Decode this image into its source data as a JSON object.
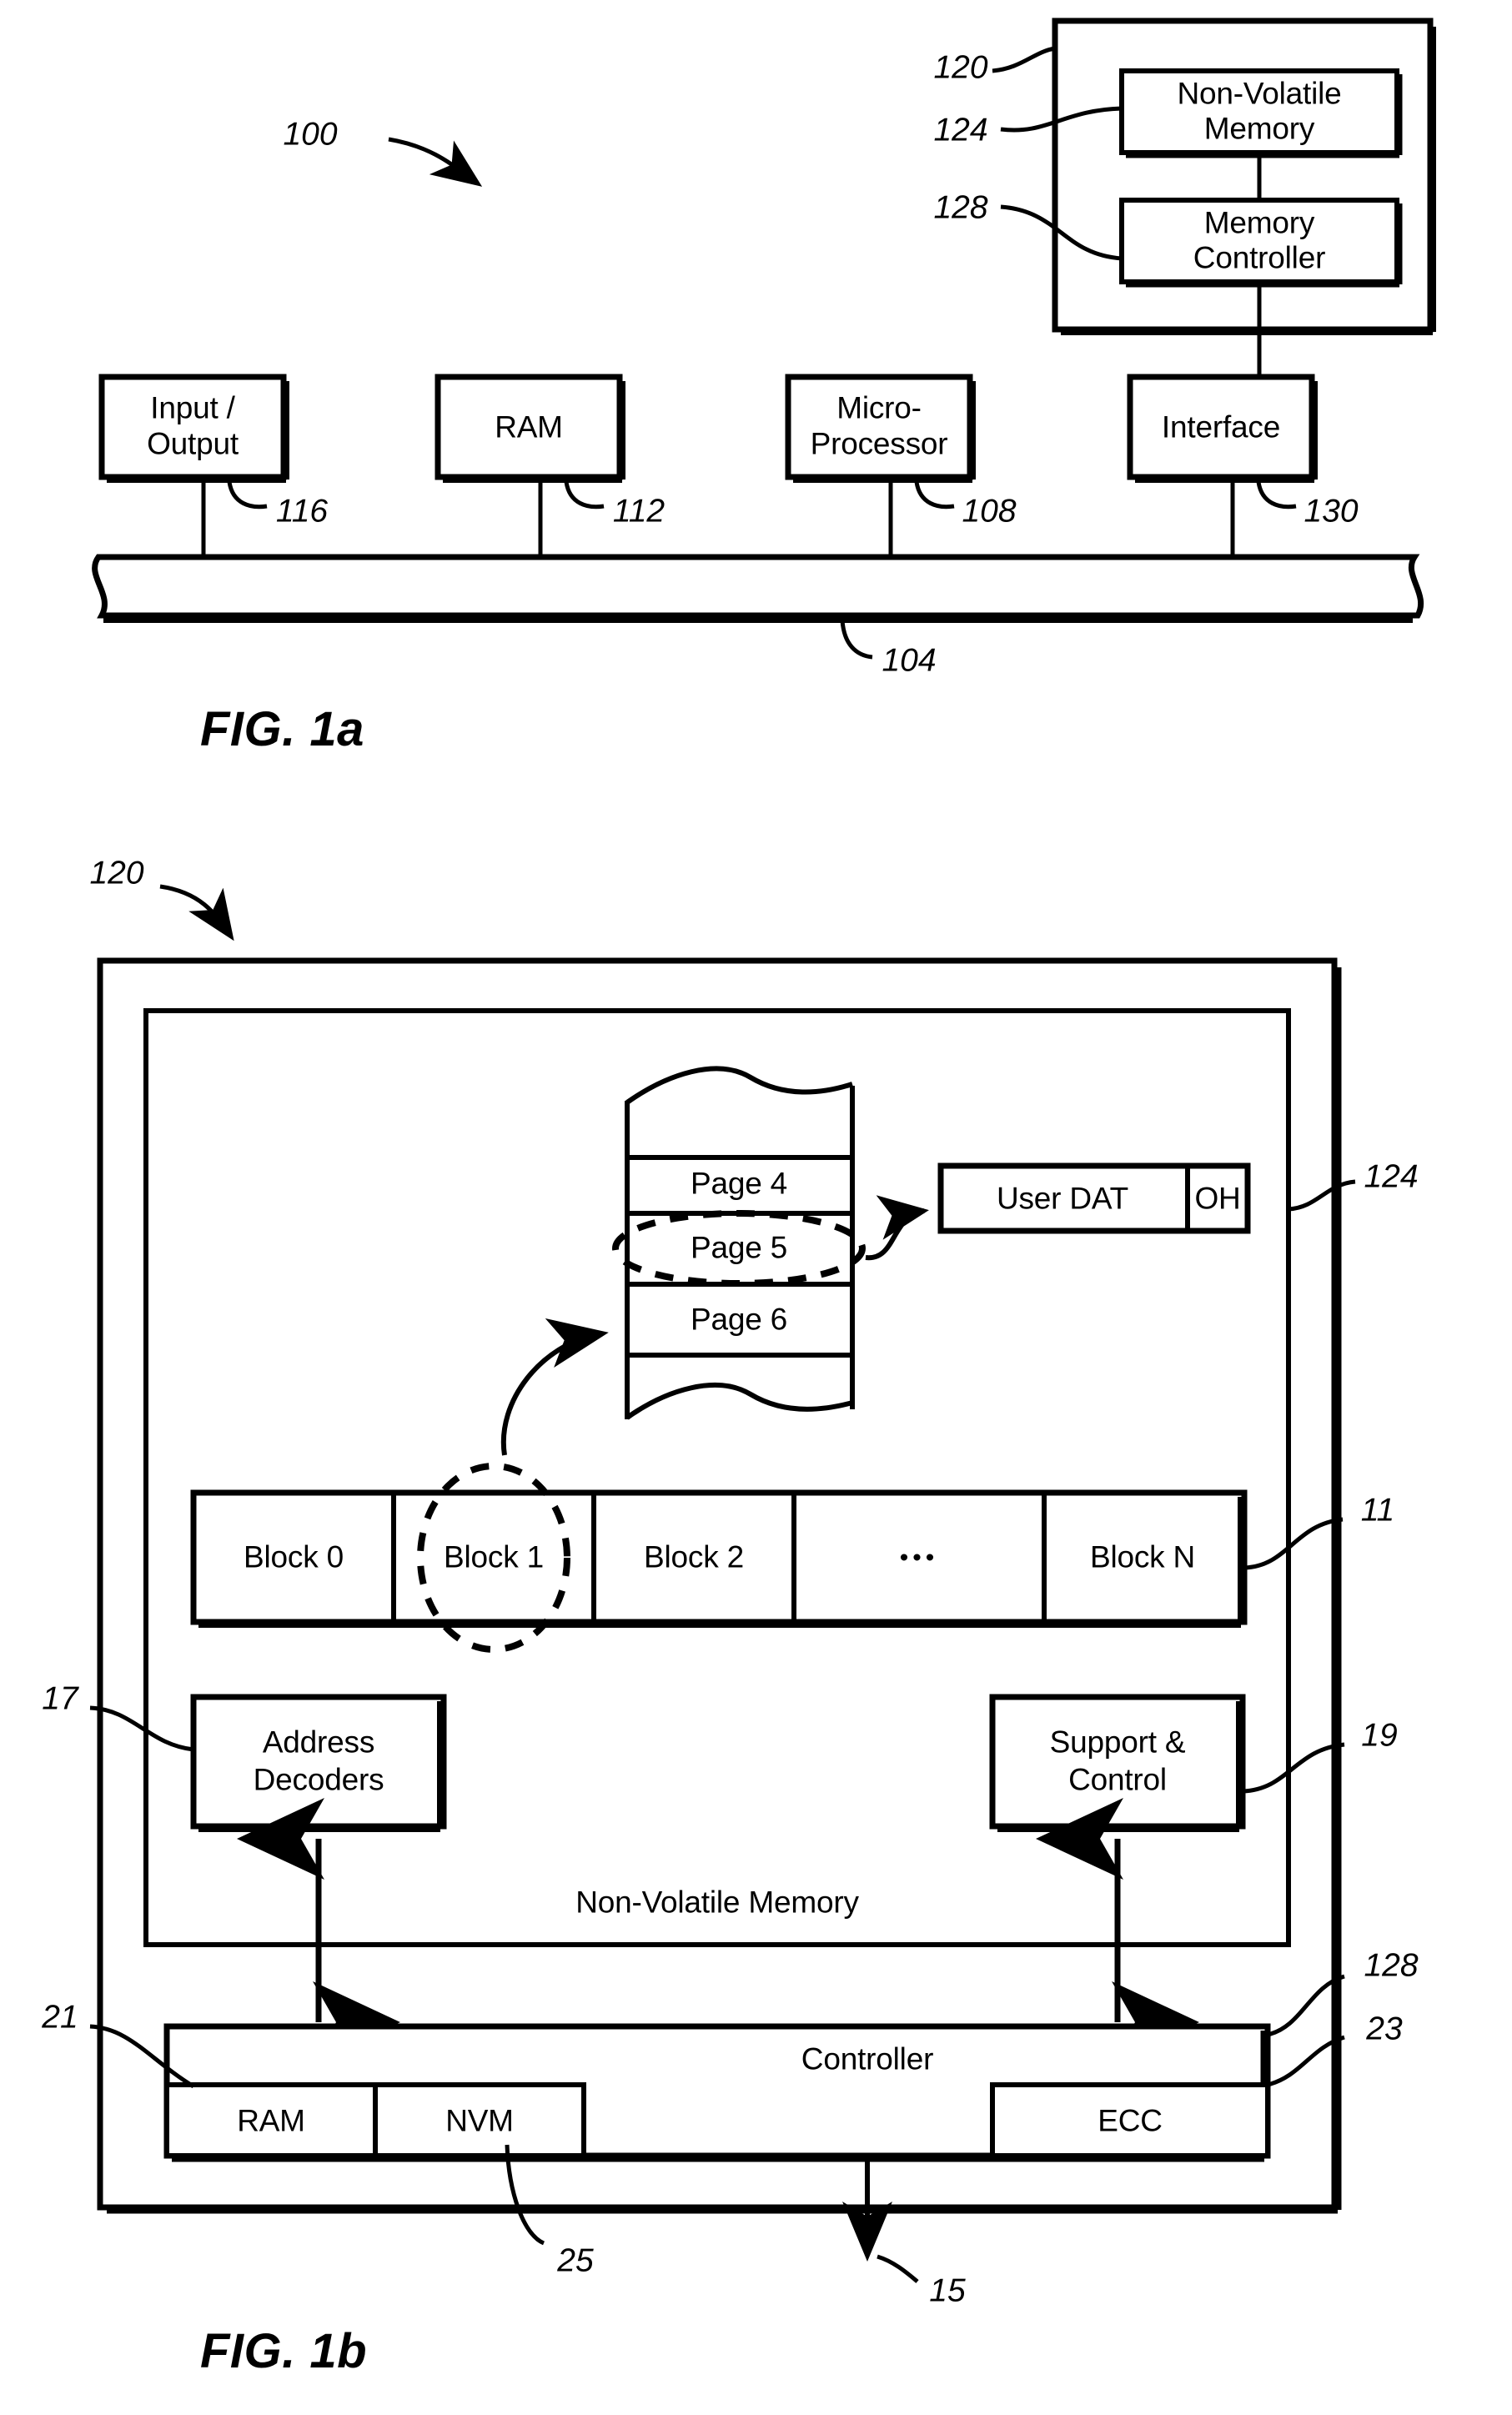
{
  "figures": [
    {
      "id": "fig-1a",
      "title": "FIG. 1a",
      "system_ref": "100",
      "bus_ref": "104",
      "blocks": [
        {
          "label": "Input /\nOutput",
          "line1": "Input /",
          "line2": "Output",
          "ref": "116"
        },
        {
          "label": "RAM",
          "line1": "RAM",
          "line2": "",
          "ref": "112"
        },
        {
          "label": "Micro-\nProcessor",
          "line1": "Micro-",
          "line2": "Processor",
          "ref": "108"
        },
        {
          "label": "Interface",
          "line1": "Interface",
          "line2": "",
          "ref": "130"
        }
      ],
      "memory_card": {
        "ref": "120",
        "children": [
          {
            "label_line1": "Non-Volatile",
            "label_line2": "Memory",
            "ref": "124"
          },
          {
            "label_line1": "Memory",
            "label_line2": "Controller",
            "ref": "128"
          }
        ]
      }
    },
    {
      "id": "fig-1b",
      "title": "FIG. 1b",
      "card_ref": "120",
      "nvm_ref": "124",
      "controller_ref": "128",
      "nvm_label": "Non-Volatile Memory",
      "controller_label": "Controller",
      "host_interface_ref": "15",
      "pages": {
        "items": [
          "Page 4",
          "Page 5",
          "Page 6"
        ],
        "highlighted": "Page 5"
      },
      "page_detail": {
        "user_data_label": "User DAT",
        "overhead_label": "OH"
      },
      "blocks": {
        "ref": "11",
        "items": [
          "Block 0",
          "Block 1",
          "Block 2",
          "•••",
          "Block N"
        ],
        "highlighted": "Block 1"
      },
      "address_decoders": {
        "line1": "Address",
        "line2": "Decoders",
        "ref": "17"
      },
      "support_control": {
        "line1": "Support &",
        "line2": "Control",
        "ref": "19"
      },
      "controller_submodules": [
        {
          "label": "RAM",
          "ref": "21"
        },
        {
          "label": "NVM",
          "ref": "25"
        },
        {
          "label": "ECC",
          "ref": "23"
        }
      ]
    }
  ]
}
